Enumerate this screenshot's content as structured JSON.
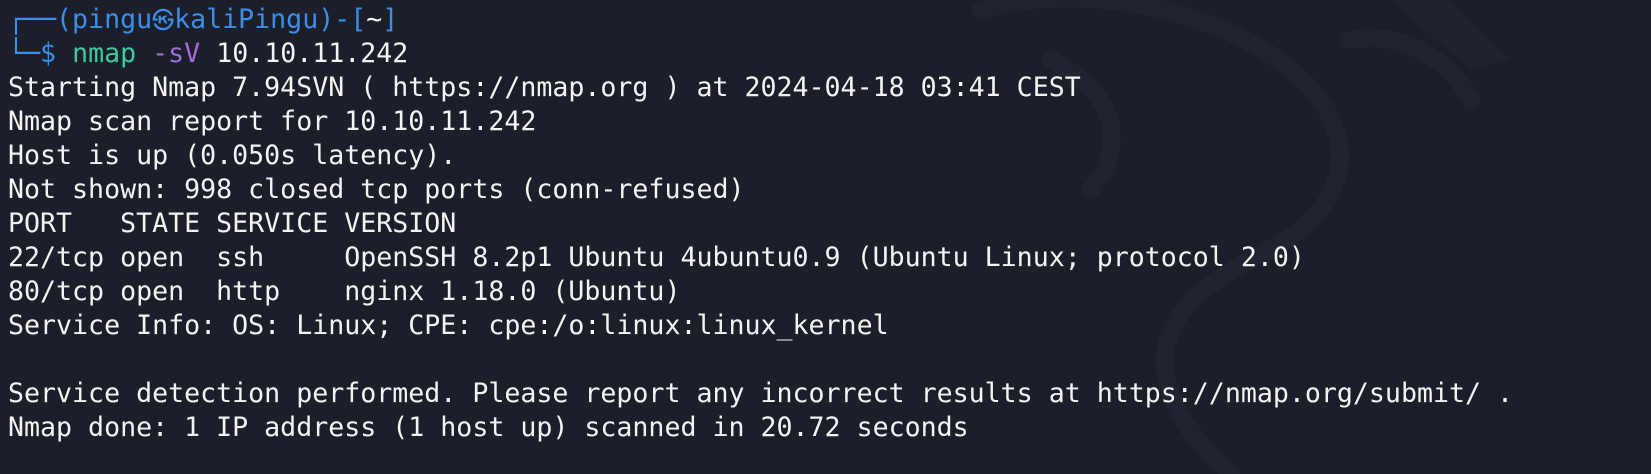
{
  "prompt": {
    "frame_top": "┌──(",
    "user": "pingu",
    "host_icon": "kali-skull-icon",
    "host": "kaliPingu",
    "mid": ")-[",
    "cwd": "~",
    "end": "]",
    "frame_bottom": "└─",
    "symbol": "$"
  },
  "command": {
    "program": "nmap",
    "flag": "-sV",
    "target": "10.10.11.242"
  },
  "output": [
    "Starting Nmap 7.94SVN ( https://nmap.org ) at 2024-04-18 03:41 CEST",
    "Nmap scan report for 10.10.11.242",
    "Host is up (0.050s latency).",
    "Not shown: 998 closed tcp ports (conn-refused)",
    "PORT   STATE SERVICE VERSION",
    "22/tcp open  ssh     OpenSSH 8.2p1 Ubuntu 4ubuntu0.9 (Ubuntu Linux; protocol 2.0)",
    "80/tcp open  http    nginx 1.18.0 (Ubuntu)",
    "Service Info: OS: Linux; CPE: cpe:/o:linux:linux_kernel",
    "",
    "Service detection performed. Please report any incorrect results at https://nmap.org/submit/ .",
    "Nmap done: 1 IP address (1 host up) scanned in 20.72 seconds"
  ],
  "colors": {
    "background": "#1c1f29",
    "frame": "#3b8eea",
    "command": "#3ec9a0",
    "flag": "#a06fd6",
    "text": "#f4f4f4"
  }
}
